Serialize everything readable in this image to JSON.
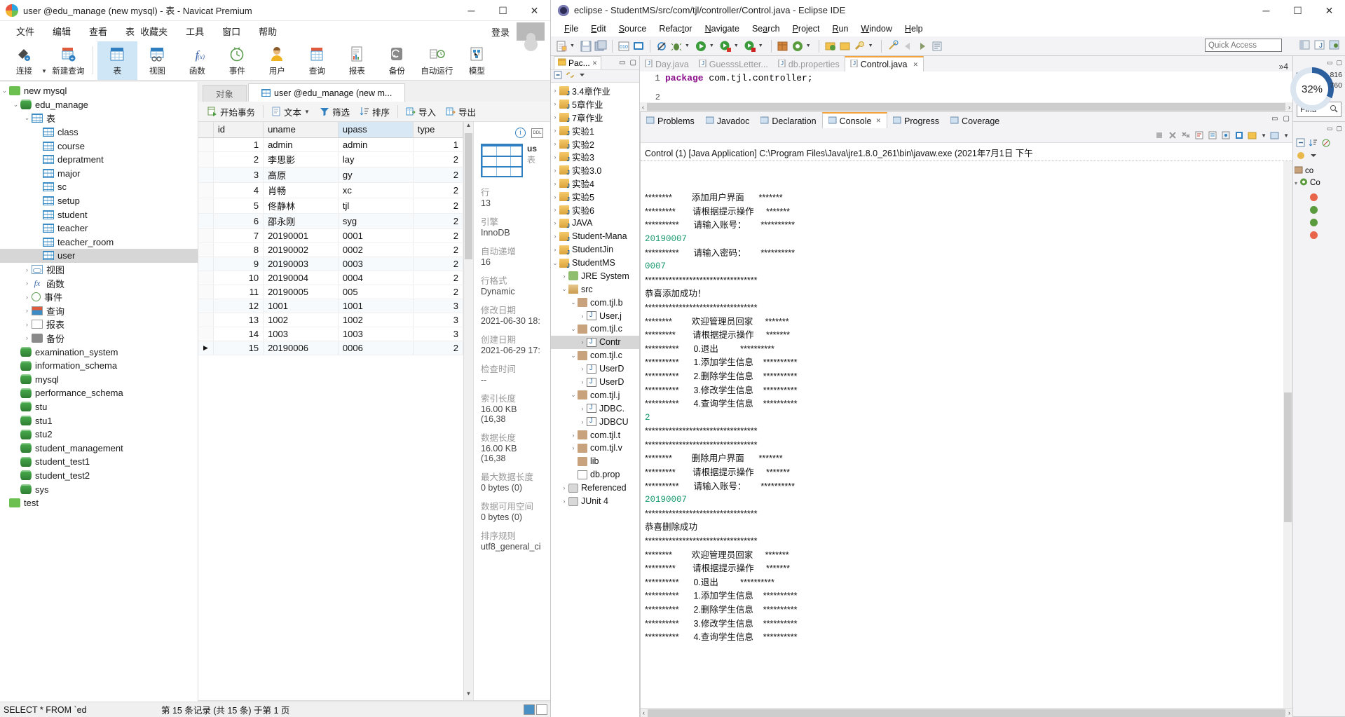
{
  "navicat": {
    "title": "user @edu_manage (new mysql) - 表 - Navicat Premium",
    "window_buttons": {
      "minimize": "─",
      "maximize": "☐",
      "close": "✕"
    },
    "menus": [
      "文件",
      "编辑",
      "查看",
      "表",
      "收藏夹",
      "工具",
      "窗口",
      "帮助"
    ],
    "login_label": "登录",
    "toolbar": [
      {
        "label": "连接",
        "icon": "connect-icon"
      },
      {
        "label": "新建查询",
        "icon": "new-query-icon"
      },
      {
        "label": "表",
        "icon": "table-icon"
      },
      {
        "label": "视图",
        "icon": "view-icon"
      },
      {
        "label": "函数",
        "icon": "function-icon"
      },
      {
        "label": "事件",
        "icon": "event-icon"
      },
      {
        "label": "用户",
        "icon": "user-icon"
      },
      {
        "label": "查询",
        "icon": "query-icon"
      },
      {
        "label": "报表",
        "icon": "report-icon"
      },
      {
        "label": "备份",
        "icon": "backup-icon"
      },
      {
        "label": "自动运行",
        "icon": "automation-icon"
      },
      {
        "label": "模型",
        "icon": "model-icon"
      }
    ],
    "tree": [
      {
        "label": "new mysql",
        "depth": 0,
        "arrow": "v",
        "icon": "connection-icon"
      },
      {
        "label": "edu_manage",
        "depth": 1,
        "arrow": "v",
        "icon": "database-icon"
      },
      {
        "label": "表",
        "depth": 2,
        "arrow": "v",
        "icon": "table-folder-icon"
      },
      {
        "label": "class",
        "depth": 3,
        "arrow": "",
        "icon": "table-icon"
      },
      {
        "label": "course",
        "depth": 3,
        "arrow": "",
        "icon": "table-icon"
      },
      {
        "label": "depratment",
        "depth": 3,
        "arrow": "",
        "icon": "table-icon"
      },
      {
        "label": "major",
        "depth": 3,
        "arrow": "",
        "icon": "table-icon"
      },
      {
        "label": "sc",
        "depth": 3,
        "arrow": "",
        "icon": "table-icon"
      },
      {
        "label": "setup",
        "depth": 3,
        "arrow": "",
        "icon": "table-icon"
      },
      {
        "label": "student",
        "depth": 3,
        "arrow": "",
        "icon": "table-icon"
      },
      {
        "label": "teacher",
        "depth": 3,
        "arrow": "",
        "icon": "table-icon"
      },
      {
        "label": "teacher_room",
        "depth": 3,
        "arrow": "",
        "icon": "table-icon"
      },
      {
        "label": "user",
        "depth": 3,
        "arrow": "",
        "icon": "table-icon",
        "selected": true
      },
      {
        "label": "视图",
        "depth": 2,
        "arrow": ">",
        "icon": "view-icon"
      },
      {
        "label": "函数",
        "depth": 2,
        "arrow": ">",
        "icon": "function-icon"
      },
      {
        "label": "事件",
        "depth": 2,
        "arrow": ">",
        "icon": "event-icon"
      },
      {
        "label": "查询",
        "depth": 2,
        "arrow": ">",
        "icon": "query-icon"
      },
      {
        "label": "报表",
        "depth": 2,
        "arrow": ">",
        "icon": "report-icon"
      },
      {
        "label": "备份",
        "depth": 2,
        "arrow": ">",
        "icon": "backup-icon"
      },
      {
        "label": "examination_system",
        "depth": 1,
        "arrow": "",
        "icon": "database-icon"
      },
      {
        "label": "information_schema",
        "depth": 1,
        "arrow": "",
        "icon": "database-icon"
      },
      {
        "label": "mysql",
        "depth": 1,
        "arrow": "",
        "icon": "database-icon"
      },
      {
        "label": "performance_schema",
        "depth": 1,
        "arrow": "",
        "icon": "database-icon"
      },
      {
        "label": "stu",
        "depth": 1,
        "arrow": "",
        "icon": "database-icon"
      },
      {
        "label": "stu1",
        "depth": 1,
        "arrow": "",
        "icon": "database-icon"
      },
      {
        "label": "stu2",
        "depth": 1,
        "arrow": "",
        "icon": "database-icon"
      },
      {
        "label": "student_management",
        "depth": 1,
        "arrow": "",
        "icon": "database-icon"
      },
      {
        "label": "student_test1",
        "depth": 1,
        "arrow": "",
        "icon": "database-icon"
      },
      {
        "label": "student_test2",
        "depth": 1,
        "arrow": "",
        "icon": "database-icon"
      },
      {
        "label": "sys",
        "depth": 1,
        "arrow": "",
        "icon": "database-icon"
      },
      {
        "label": "test",
        "depth": 0,
        "arrow": "",
        "icon": "connection-icon"
      }
    ],
    "tabs": [
      {
        "label": "对象",
        "active": false
      },
      {
        "label": "user @edu_manage (new m...",
        "active": true
      }
    ],
    "grid_toolbar": [
      {
        "label": "开始事务",
        "icon": "transaction-icon"
      },
      {
        "label": "文本",
        "icon": "text-icon",
        "caret": true
      },
      {
        "label": "筛选",
        "icon": "filter-icon"
      },
      {
        "label": "排序",
        "icon": "sort-icon"
      },
      {
        "label": "导入",
        "icon": "import-icon"
      },
      {
        "label": "导出",
        "icon": "export-icon"
      }
    ],
    "grid": {
      "columns": [
        "id",
        "uname",
        "upass",
        "type"
      ],
      "highlighted_column": "upass",
      "rows": [
        {
          "id": "1",
          "uname": "admin",
          "upass": "admin",
          "type": "1"
        },
        {
          "id": "2",
          "uname": "李思影",
          "upass": "lay",
          "type": "2"
        },
        {
          "id": "3",
          "uname": "高原",
          "upass": "gy",
          "type": "2"
        },
        {
          "id": "4",
          "uname": "肖畅",
          "upass": "xc",
          "type": "2"
        },
        {
          "id": "5",
          "uname": "佟静林",
          "upass": "tjl",
          "type": "2"
        },
        {
          "id": "6",
          "uname": "邵永刚",
          "upass": "syg",
          "type": "2"
        },
        {
          "id": "7",
          "uname": "20190001",
          "upass": "0001",
          "type": "2"
        },
        {
          "id": "8",
          "uname": "20190002",
          "upass": "0002",
          "type": "2"
        },
        {
          "id": "9",
          "uname": "20190003",
          "upass": "0003",
          "type": "2"
        },
        {
          "id": "10",
          "uname": "20190004",
          "upass": "0004",
          "type": "2"
        },
        {
          "id": "11",
          "uname": "20190005",
          "upass": "005",
          "type": "2"
        },
        {
          "id": "12",
          "uname": "1001",
          "upass": "1001",
          "type": "3"
        },
        {
          "id": "13",
          "uname": "1002",
          "upass": "1002",
          "type": "3"
        },
        {
          "id": "14",
          "uname": "1003",
          "upass": "1003",
          "type": "3"
        },
        {
          "id": "15",
          "uname": "20190006",
          "upass": "0006",
          "type": "2",
          "current": true,
          "selected_cell": "upass"
        }
      ]
    },
    "info": {
      "table_name": "us",
      "table_type": "表",
      "fields": [
        {
          "key": "行",
          "value": "13"
        },
        {
          "key": "引擎",
          "value": "InnoDB"
        },
        {
          "key": "自动递增",
          "value": "16"
        },
        {
          "key": "行格式",
          "value": "Dynamic"
        },
        {
          "key": "修改日期",
          "value": "2021-06-30 18:"
        },
        {
          "key": "创建日期",
          "value": "2021-06-29 17:"
        },
        {
          "key": "检查时间",
          "value": "--"
        },
        {
          "key": "索引长度",
          "value": "16.00 KB (16,38"
        },
        {
          "key": "数据长度",
          "value": "16.00 KB (16,38"
        },
        {
          "key": "最大数据长度",
          "value": "0 bytes (0)"
        },
        {
          "key": "数据可用空间",
          "value": "0 bytes (0)"
        },
        {
          "key": "排序规则",
          "value": "utf8_general_ci"
        }
      ]
    },
    "pager": {
      "add": "+",
      "remove": "−",
      "confirm": "✓",
      "cancel": "✗",
      "refresh": "↺",
      "stop": "⊘",
      "prev": "←",
      "page": "1",
      "next": "→",
      "last": "⇥",
      "settings": "⚙",
      "grid_view": "grid-view-icon",
      "form_view": "form-view-icon"
    },
    "status": {
      "sql": "SELECT * FROM `ed",
      "record_info": "第 15 条记录 (共 15 条)  于第 1 页"
    }
  },
  "eclipse": {
    "title": "eclipse - StudentMS/src/com/tjl/controller/Control.java - Eclipse IDE",
    "window_buttons": {
      "minimize": "─",
      "maximize": "☐",
      "close": "✕"
    },
    "menus": [
      "File",
      "Edit",
      "Source",
      "Refactor",
      "Navigate",
      "Search",
      "Project",
      "Run",
      "Window",
      "Help"
    ],
    "quick_access": "Quick Access",
    "package_explorer": {
      "tab_label": "Pac...",
      "items": [
        {
          "label": "3.4章作业",
          "depth": 0,
          "arrow": ">",
          "icon": "java-project-icon"
        },
        {
          "label": "5章作业",
          "depth": 0,
          "arrow": ">",
          "icon": "java-project-icon"
        },
        {
          "label": "7章作业",
          "depth": 0,
          "arrow": ">",
          "icon": "java-project-icon"
        },
        {
          "label": "实验1",
          "depth": 0,
          "arrow": ">",
          "icon": "java-project-icon"
        },
        {
          "label": "实验2",
          "depth": 0,
          "arrow": ">",
          "icon": "java-project-icon"
        },
        {
          "label": "实验3",
          "depth": 0,
          "arrow": ">",
          "icon": "java-project-icon"
        },
        {
          "label": "实验3.0",
          "depth": 0,
          "arrow": ">",
          "icon": "java-project-icon"
        },
        {
          "label": "实验4",
          "depth": 0,
          "arrow": ">",
          "icon": "java-project-icon"
        },
        {
          "label": "实验5",
          "depth": 0,
          "arrow": ">",
          "icon": "java-project-icon"
        },
        {
          "label": "实验6",
          "depth": 0,
          "arrow": ">",
          "icon": "java-project-icon"
        },
        {
          "label": "JAVA",
          "depth": 0,
          "arrow": ">",
          "icon": "java-project-icon"
        },
        {
          "label": "Student-Mana",
          "depth": 0,
          "arrow": ">",
          "icon": "java-project-icon"
        },
        {
          "label": "StudentJin",
          "depth": 0,
          "arrow": ">",
          "icon": "java-project-icon"
        },
        {
          "label": "StudentMS",
          "depth": 0,
          "arrow": "v",
          "icon": "java-project-icon"
        },
        {
          "label": "JRE System",
          "depth": 1,
          "arrow": ">",
          "icon": "jre-library-icon"
        },
        {
          "label": "src",
          "depth": 1,
          "arrow": "v",
          "icon": "source-folder-icon"
        },
        {
          "label": "com.tjl.b",
          "depth": 2,
          "arrow": "v",
          "icon": "package-icon"
        },
        {
          "label": "User.j",
          "depth": 3,
          "arrow": ">",
          "icon": "java-file-icon"
        },
        {
          "label": "com.tjl.c",
          "depth": 2,
          "arrow": "v",
          "icon": "package-icon"
        },
        {
          "label": "Contr",
          "depth": 3,
          "arrow": ">",
          "icon": "java-file-icon",
          "selected": true
        },
        {
          "label": "com.tjl.c",
          "depth": 2,
          "arrow": "v",
          "icon": "package-icon"
        },
        {
          "label": "UserD",
          "depth": 3,
          "arrow": ">",
          "icon": "java-file-icon"
        },
        {
          "label": "UserD",
          "depth": 3,
          "arrow": ">",
          "icon": "java-interface-icon"
        },
        {
          "label": "com.tjl.j",
          "depth": 2,
          "arrow": "v",
          "icon": "package-icon"
        },
        {
          "label": "JDBC.",
          "depth": 3,
          "arrow": ">",
          "icon": "java-file-icon"
        },
        {
          "label": "JDBCU",
          "depth": 3,
          "arrow": ">",
          "icon": "java-file-icon"
        },
        {
          "label": "com.tjl.t",
          "depth": 2,
          "arrow": ">",
          "icon": "package-icon"
        },
        {
          "label": "com.tjl.v",
          "depth": 2,
          "arrow": ">",
          "icon": "package-icon"
        },
        {
          "label": "lib",
          "depth": 2,
          "arrow": "",
          "icon": "package-icon"
        },
        {
          "label": "db.prop",
          "depth": 2,
          "arrow": "",
          "icon": "properties-file-icon"
        },
        {
          "label": "Referenced",
          "depth": 1,
          "arrow": ">",
          "icon": "library-icon"
        },
        {
          "label": "JUnit 4",
          "depth": 1,
          "arrow": ">",
          "icon": "library-icon"
        }
      ]
    },
    "editor": {
      "tabs": [
        {
          "label": "Day.java",
          "active": false,
          "icon": "java-file-icon"
        },
        {
          "label": "GuesssLetter...",
          "active": false,
          "icon": "java-file-icon"
        },
        {
          "label": "db.properties",
          "active": false,
          "icon": "properties-file-icon"
        },
        {
          "label": "Control.java",
          "active": true,
          "icon": "java-file-icon"
        }
      ],
      "more_tabs": "»4",
      "line_numbers": [
        "1",
        "2"
      ],
      "code_keyword": "package",
      "code_rest": " com.tjl.controller;"
    },
    "console": {
      "tabs": [
        {
          "label": "Problems",
          "active": false,
          "icon": "problems-icon"
        },
        {
          "label": "Javadoc",
          "active": false,
          "icon": "javadoc-icon"
        },
        {
          "label": "Declaration",
          "active": false,
          "icon": "declaration-icon"
        },
        {
          "label": "Console",
          "active": true,
          "icon": "console-icon",
          "closable": true
        },
        {
          "label": "Progress",
          "active": false,
          "icon": "progress-icon"
        },
        {
          "label": "Coverage",
          "active": false,
          "icon": "coverage-icon"
        }
      ],
      "launch_header": "Control (1) [Java Application] C:\\Program Files\\Java\\jre1.8.0_261\\bin\\javaw.exe (2021年7月1日 下午",
      "lines": [
        {
          "text": "********        添加用户界面      *******",
          "type": "out"
        },
        {
          "text": "*********       请根据提示操作     *******",
          "type": "out"
        },
        {
          "text": "**********      请输入账号：      **********",
          "type": "out"
        },
        {
          "text": "20190007",
          "type": "in"
        },
        {
          "text": "**********      请输入密码：      **********",
          "type": "out"
        },
        {
          "text": "0007",
          "type": "in"
        },
        {
          "text": "*********************************",
          "type": "out"
        },
        {
          "text": "恭喜添加成功！",
          "type": "out"
        },
        {
          "text": "*********************************",
          "type": "out"
        },
        {
          "text": "********        欢迎管理员回家     *******",
          "type": "out"
        },
        {
          "text": "*********       请根据提示操作     *******",
          "type": "out"
        },
        {
          "text": "**********      0.退出         **********",
          "type": "out"
        },
        {
          "text": "**********      1.添加学生信息    **********",
          "type": "out"
        },
        {
          "text": "**********      2.删除学生信息    **********",
          "type": "out"
        },
        {
          "text": "**********      3.修改学生信息    **********",
          "type": "out"
        },
        {
          "text": "**********      4.查询学生信息    **********",
          "type": "out"
        },
        {
          "text": "2",
          "type": "in"
        },
        {
          "text": "*********************************",
          "type": "out"
        },
        {
          "text": "*********************************",
          "type": "out"
        },
        {
          "text": "********        删除用户界面      *******",
          "type": "out"
        },
        {
          "text": "*********       请根据提示操作     *******",
          "type": "out"
        },
        {
          "text": "**********      请输入账号：      **********",
          "type": "out"
        },
        {
          "text": "20190007",
          "type": "in"
        },
        {
          "text": "*********************************",
          "type": "out"
        },
        {
          "text": "恭喜删除成功",
          "type": "out"
        },
        {
          "text": "*********************************",
          "type": "out"
        },
        {
          "text": "********        欢迎管理员回家     *******",
          "type": "out"
        },
        {
          "text": "*********       请根据提示操作     *******",
          "type": "out"
        },
        {
          "text": "**********      0.退出         **********",
          "type": "out"
        },
        {
          "text": "**********      1.添加学生信息    **********",
          "type": "out"
        },
        {
          "text": "**********      2.删除学生信息    **********",
          "type": "out"
        },
        {
          "text": "**********      3.修改学生信息    **********",
          "type": "out"
        },
        {
          "text": "**********      4.查询学生信息    **********",
          "type": "out"
        }
      ]
    },
    "progress_widget": {
      "percent": "32%",
      "value_top": "816",
      "value_bottom": "760"
    },
    "find_label": "Find",
    "outline": {
      "items": [
        "co",
        "Co"
      ]
    }
  }
}
